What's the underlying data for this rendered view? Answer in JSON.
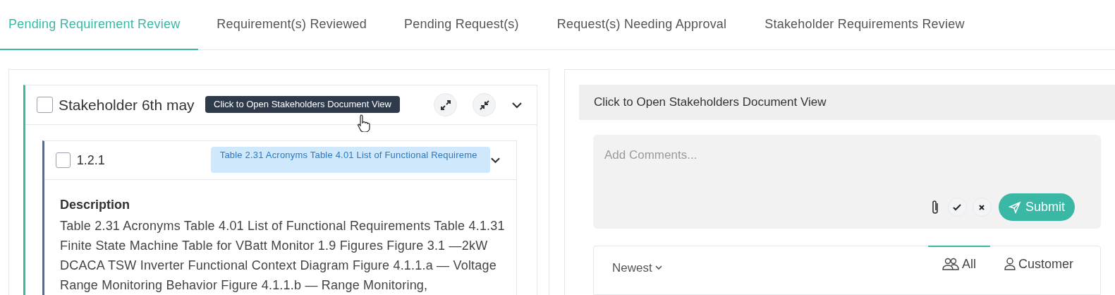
{
  "tabs": [
    {
      "label": "Pending Requirement Review",
      "selected": true
    },
    {
      "label": "Requirement(s) Reviewed",
      "selected": false
    },
    {
      "label": "Pending Request(s)",
      "selected": false
    },
    {
      "label": "Request(s) Needing Approval",
      "selected": false
    },
    {
      "label": "Stakeholder Requirements Review",
      "selected": false
    }
  ],
  "stakeholder_card": {
    "title": "Stakeholder 6th may",
    "checked": false,
    "tooltip": "Click to Open Stakeholders Document View",
    "requirement": {
      "number": "1.2.1",
      "checked": false,
      "tag": "Table 2.31 Acronyms Table 4.01 List of Functional Requireme",
      "description_heading": "Description",
      "description": "Table 2.31 Acronyms Table 4.01 List of Functional Requirements Table 4.1.31 Finite State Machine Table for VBatt Monitor 1.9 Figures Figure 3.1 —2kW DCACA TSW Inverter Functional Context Diagram Figure 4.1.1.a — Voltage Range Monitoring Behavior Figure 4.1.1.b — Range Monitoring,"
    }
  },
  "document_view_bar": "Click to Open Stakeholders Document View",
  "comment_box": {
    "placeholder": "Add Comments...",
    "submit": "Submit"
  },
  "comments": {
    "sort": "Newest",
    "filters": [
      {
        "label": "All",
        "kind": "group",
        "selected": true
      },
      {
        "label": "Customer",
        "kind": "person",
        "selected": false
      }
    ]
  }
}
